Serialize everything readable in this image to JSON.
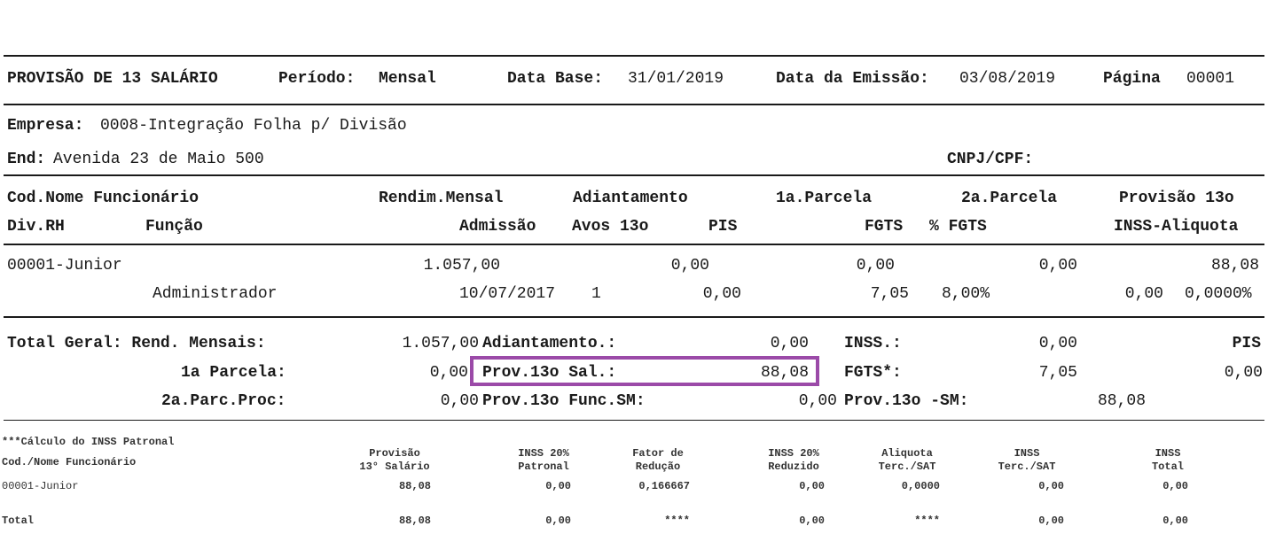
{
  "header": {
    "title": "PROVISÃO DE 13 SALÁRIO",
    "periodo_label": "Período:",
    "periodo_value": "Mensal",
    "data_base_label": "Data Base:",
    "data_base_value": "31/01/2019",
    "emissao_label": "Data da Emissão:",
    "emissao_value": "03/08/2019",
    "pagina_label": "Página",
    "pagina_value": "00001"
  },
  "company": {
    "empresa_label": "Empresa:",
    "empresa_value": "0008-Integração Folha p/ Divisão",
    "end_label": "End:",
    "end_value": "Avenida 23 de Maio 500",
    "cnpj_label": "CNPJ/CPF:"
  },
  "columns": {
    "row1": [
      "Cod.Nome Funcionário",
      "Rendim.Mensal",
      "Adiantamento",
      "1a.Parcela",
      "2a.Parcela",
      "Provisão 13o"
    ],
    "row2": [
      "Div.RH",
      "Função",
      "Admissão",
      "Avos 13o",
      "PIS",
      "FGTS",
      "% FGTS",
      "INSS-Aliquota"
    ]
  },
  "employee": {
    "name": "00001-Junior",
    "rendim": "1.057,00",
    "adiantamento": "0,00",
    "parcela1": "0,00",
    "parcela2": "0,00",
    "provisao": "88,08",
    "funcao": "Administrador",
    "admissao": "10/07/2017",
    "avos": "1",
    "pis": "0,00",
    "fgts": "7,05",
    "pct_fgts": "8,00%",
    "inss": "0,00",
    "aliquota": "0,0000%"
  },
  "totals": {
    "total_label": "Total Geral: Rend. Mensais:",
    "rend_value": "1.057,00",
    "adiant_label": "Adiantamento.:",
    "adiant_value": "0,00",
    "inss_label": "INSS.:",
    "inss_value": "0,00",
    "pis_label": "PIS",
    "parcela1_label": "1a Parcela:",
    "parcela1_value": "0,00",
    "prov13_label": "Prov.13o Sal.:",
    "prov13_value": "88,08",
    "fgts_label": "FGTS*:",
    "fgts_value": "7,05",
    "pis_value": "0,00",
    "parc2_label": "2a.Parc.Proc:",
    "parc2_value": "0,00",
    "func_sm_label": "Prov.13o Func.SM:",
    "func_sm_value": "0,00",
    "prov_sm_label": "Prov.13o -SM:",
    "prov_sm_value": "88,08"
  },
  "inss_section": {
    "title": "***Cálculo do INSS Patronal",
    "name_header": "Cod./Nome Funcionário",
    "headers": [
      [
        "Provisão",
        "13° Salário"
      ],
      [
        "INSS 20%",
        "Patronal"
      ],
      [
        "Fator de",
        "Redução"
      ],
      [
        "INSS 20%",
        "Reduzido"
      ],
      [
        "Aliquota",
        "Terc./SAT"
      ],
      [
        "INSS",
        "Terc./SAT"
      ],
      [
        "INSS",
        "Total"
      ]
    ],
    "row_name": "00001-Junior",
    "row_values": [
      "88,08",
      "0,00",
      "0,166667",
      "0,00",
      "0,0000",
      "0,00",
      "0,00"
    ],
    "total_label": "Total",
    "total_values": [
      "88,08",
      "0,00",
      "****",
      "0,00",
      "****",
      "0,00",
      "0,00"
    ]
  },
  "colors": {
    "highlight": "#9b4aa8",
    "text": "#1a1a1a"
  }
}
